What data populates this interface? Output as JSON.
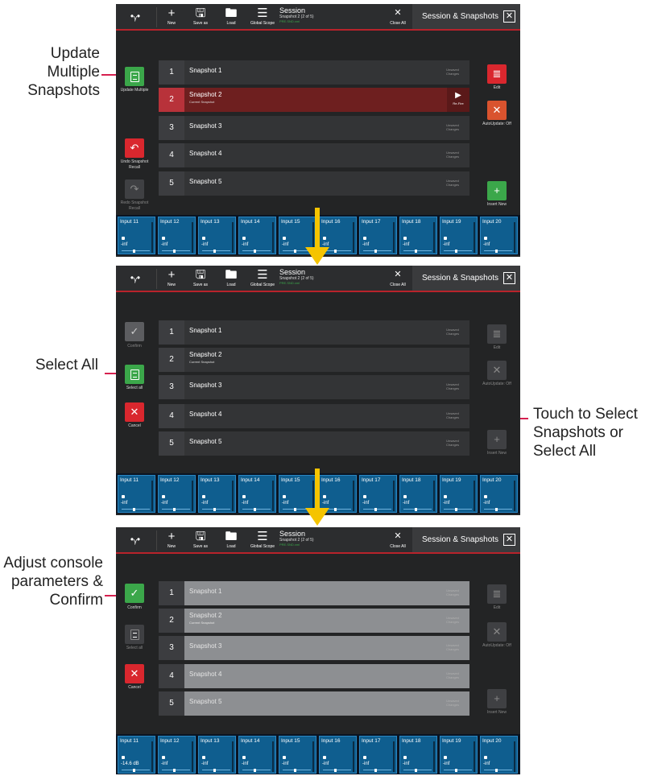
{
  "toolbar": {
    "new_label": "New",
    "save_label": "Save as",
    "load_label": "Load",
    "global_label": "Global Scope",
    "session_title": "Session",
    "session_sub": "Snapshot 2 (2 of 5)",
    "session_green": "PRE.SND.xml",
    "close_all_label": "Close All",
    "panel_title": "Session & Snapshots",
    "plus_glyph": "+",
    "save_glyph": "🖫",
    "folder_glyph": "🖿",
    "list_glyph": "☰",
    "close_glyph": "✕",
    "logo_glyph": "•ᵧ•"
  },
  "snapshots": [
    {
      "num": "1",
      "name": "Snapshot 1",
      "sub": "",
      "unsaved": "Unsaved Changes"
    },
    {
      "num": "2",
      "name": "Snapshot 2",
      "sub": "Current Snapshot",
      "unsaved": "Unsaved Changes"
    },
    {
      "num": "3",
      "name": "Snapshot 3",
      "sub": "",
      "unsaved": "Unsaved Changes"
    },
    {
      "num": "4",
      "name": "Snapshot 4",
      "sub": "",
      "unsaved": "Unsaved Changes"
    },
    {
      "num": "5",
      "name": "Snapshot 5",
      "sub": "",
      "unsaved": "Unsaved Changes"
    }
  ],
  "refire": {
    "glyph": "▶",
    "label": "Re-Fire"
  },
  "panel1": {
    "update_multiple": "Update Multiple",
    "undo_recall": "Undo Snapshot Recall",
    "redo_recall": "Redo Snapshot Recall",
    "edit": "Edit",
    "autoupdate": "AutoUpdate: Off",
    "insert_new": "Insert New"
  },
  "panel2": {
    "confirm": "Confirm",
    "select_all": "Select all",
    "cancel": "Cancel",
    "edit": "Edit",
    "autoupdate": "AutoUpdate: Off",
    "insert_new": "Insert New"
  },
  "panel3": {
    "confirm": "Confirm",
    "select_all": "Select all",
    "cancel": "Cancel",
    "edit": "Edit",
    "autoupdate": "AutoUpdate: Off",
    "insert_new": "Insert New"
  },
  "glyphs": {
    "check": "✓",
    "cross": "✕",
    "plus": "+",
    "undo": "↶",
    "redo": "↷",
    "list": "≣"
  },
  "channels": [
    "Input 11",
    "Input 12",
    "Input 13",
    "Input 14",
    "Input 15",
    "Input 16",
    "Input 17",
    "Input 18",
    "Input 19",
    "Input 20"
  ],
  "channel_value_default": "-inf",
  "channel_value_adjusted": "-14.6 dB",
  "annotations": {
    "update_multiple": "Update Multiple Snapshots",
    "select_all": "Select All",
    "touch_select": "Touch to Select Snapshots or Select All",
    "adjust": "Adjust console parameters & Confirm"
  },
  "colors": {
    "accent_red": "#b8232b",
    "green": "#3ba74a",
    "red": "#d9272e",
    "orange": "#d9532e",
    "channel_blue": "#0f5e8f",
    "arrow_yellow": "#f5c400",
    "pointer_pink": "#d6204f"
  }
}
